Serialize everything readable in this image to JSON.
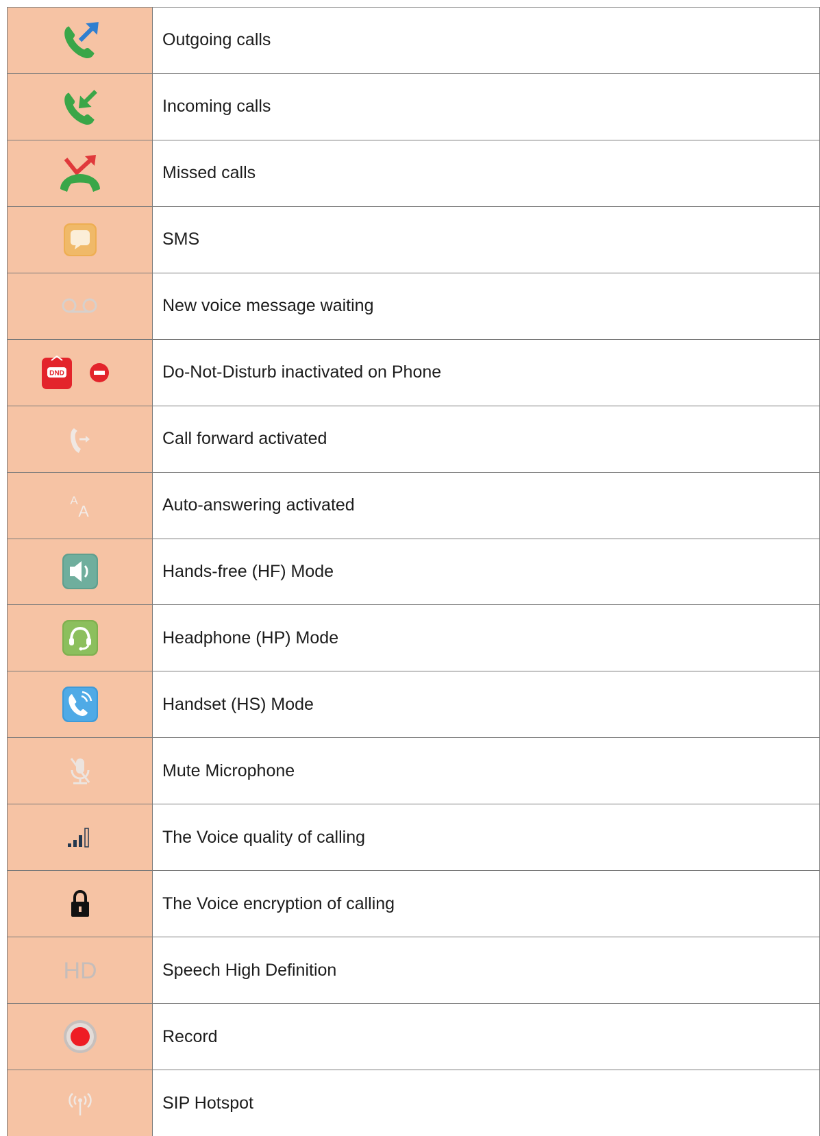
{
  "rows": [
    {
      "icon": "outgoing-call-icon",
      "label": "Outgoing calls"
    },
    {
      "icon": "incoming-call-icon",
      "label": "Incoming calls"
    },
    {
      "icon": "missed-call-icon",
      "label": "Missed calls"
    },
    {
      "icon": "sms-icon",
      "label": "SMS"
    },
    {
      "icon": "voicemail-icon",
      "label": "New voice message waiting"
    },
    {
      "icon": "dnd-icon",
      "icon_text": "DND",
      "label": "Do-Not-Disturb inactivated on Phone"
    },
    {
      "icon": "call-forward-icon",
      "label": "Call forward activated"
    },
    {
      "icon": "auto-answer-icon",
      "icon_text": "AA",
      "label": "Auto-answering activated"
    },
    {
      "icon": "speaker-icon",
      "label": "Hands-free (HF) Mode"
    },
    {
      "icon": "headphone-icon",
      "label": "Headphone (HP) Mode"
    },
    {
      "icon": "handset-icon",
      "label": "Handset (HS) Mode"
    },
    {
      "icon": "mute-microphone-icon",
      "label": "Mute Microphone"
    },
    {
      "icon": "signal-quality-icon",
      "label": "The Voice quality of calling"
    },
    {
      "icon": "lock-icon",
      "label": "The Voice encryption of calling"
    },
    {
      "icon": "hd-icon",
      "icon_text": "HD",
      "label": "Speech High Definition"
    },
    {
      "icon": "record-icon",
      "label": "Record"
    },
    {
      "icon": "sip-hotspot-icon",
      "label": "SIP Hotspot"
    }
  ],
  "colors": {
    "icon_column_bg": "#f6c3a4",
    "border": "#7a7a7a",
    "call_green": "#3aa648",
    "arrow_blue": "#2f7fd0",
    "missed_red": "#e0393b"
  }
}
